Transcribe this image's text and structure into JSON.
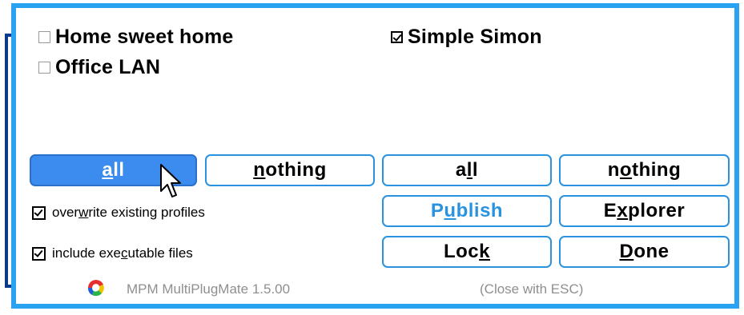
{
  "profiles": {
    "left": [
      {
        "label": "Home sweet home",
        "checked": false
      },
      {
        "label": "Office LAN",
        "checked": false
      }
    ],
    "right": [
      {
        "label": "Simple Simon",
        "checked": true
      }
    ]
  },
  "left_buttons": {
    "all": {
      "label": "all",
      "hotkey": "a",
      "active": true
    },
    "nothing": {
      "label": "nothing",
      "hotkey": "n"
    }
  },
  "right_buttons": {
    "all": {
      "label": "all",
      "hotkey": "l"
    },
    "nothing": {
      "label": "nothing",
      "hotkey": "o"
    }
  },
  "actions": {
    "publish": {
      "label": "Publish",
      "hotkey": "u",
      "color": "#2a93df"
    },
    "explorer": {
      "label": "Explorer",
      "hotkey": "x"
    },
    "lock": {
      "label": "Lock",
      "hotkey": "k"
    },
    "done": {
      "label": "Done",
      "hotkey": "D"
    }
  },
  "options": {
    "overwrite": {
      "label": "overwrite existing profiles",
      "hotkey": "w",
      "checked": true
    },
    "executables": {
      "label": "include executable files",
      "hotkey": "c",
      "checked": true
    }
  },
  "footer": {
    "app_name": "MPM MultiPlugMate 1.5.00",
    "close_hint": "(Close with ESC)",
    "logo_icon": "multiplugmate-logo-icon"
  },
  "colors": {
    "frame": "#2aa2f2",
    "button_border": "#2a93df",
    "active_button": "#3c8cef",
    "footer_text": "#8f8f8f"
  }
}
